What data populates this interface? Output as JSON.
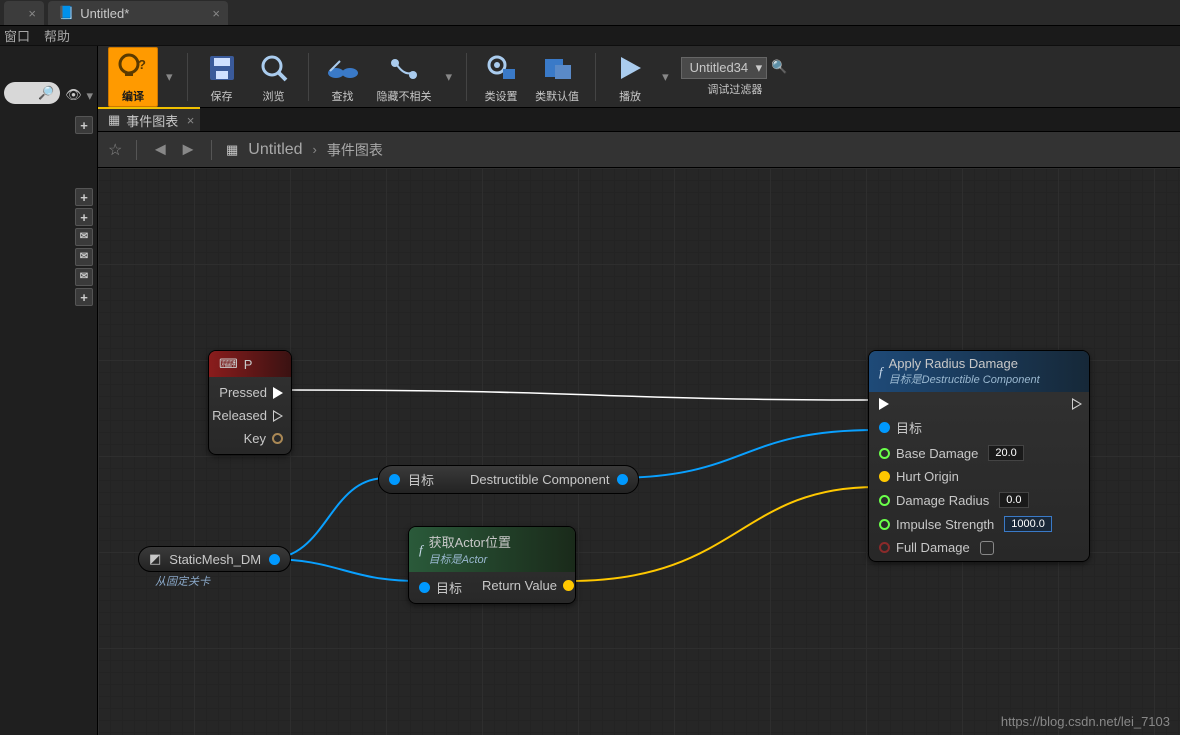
{
  "app_tabs": {
    "main_close": "×",
    "doc_title": "Untitled*",
    "doc_close": "×"
  },
  "menu": {
    "window": "窗口",
    "help": "帮助"
  },
  "toolbar": {
    "compile": "编译",
    "save": "保存",
    "browse": "浏览",
    "find": "查找",
    "hide": "隐藏不相关",
    "class_settings": "类设置",
    "class_defaults": "类默认值",
    "play": "播放",
    "debug_filter_label": "调试过滤器",
    "debug_filter_value": "Untitled34"
  },
  "doc_tab": "事件图表",
  "breadcrumb": {
    "a": "Untitled",
    "b": "事件图表"
  },
  "nodes": {
    "input": {
      "title": "P",
      "pressed": "Pressed",
      "released": "Released",
      "key": "Key"
    },
    "varref": {
      "name": "StaticMesh_DM",
      "sub": "从固定关卡"
    },
    "cast": {
      "target": "目标",
      "output": "Destructible Component"
    },
    "getloc": {
      "title": "获取Actor位置",
      "sub": "目标是Actor",
      "target": "目标",
      "return": "Return Value"
    },
    "damage": {
      "title": "Apply Radius Damage",
      "sub": "目标是Destructible Component",
      "target": "目标",
      "base": "Base Damage",
      "base_v": "20.0",
      "origin": "Hurt Origin",
      "radius": "Damage Radius",
      "radius_v": "0.0",
      "impulse": "Impulse Strength",
      "impulse_v": "1000.0",
      "full": "Full Damage"
    }
  },
  "watermark": "https://blog.csdn.net/lei_7103"
}
